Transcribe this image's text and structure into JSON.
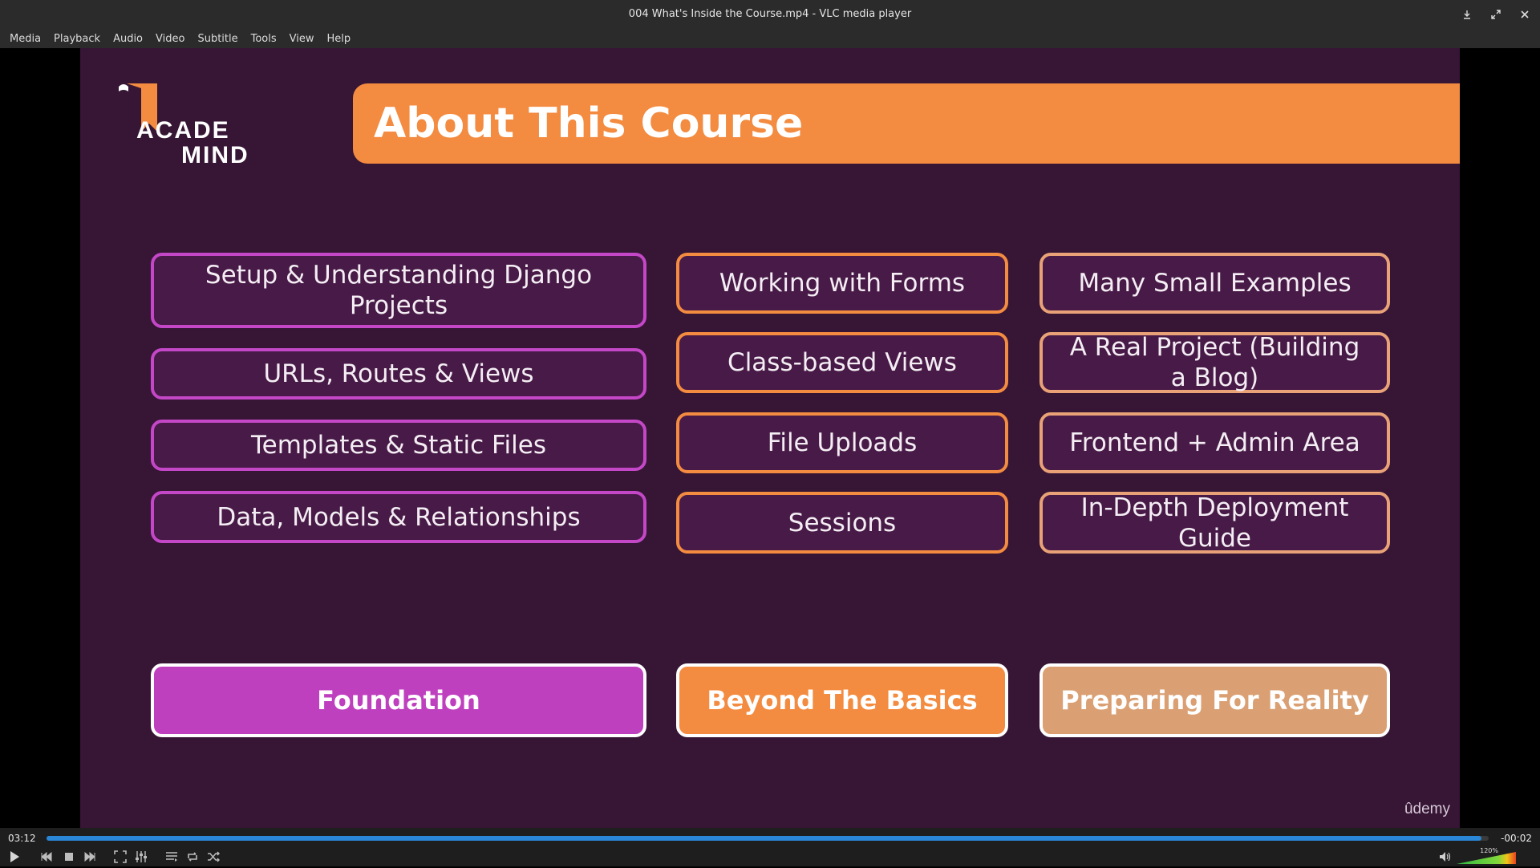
{
  "window": {
    "title": "004 What's Inside the Course.mp4 - VLC media player"
  },
  "menu": [
    "Media",
    "Playback",
    "Audio",
    "Video",
    "Subtitle",
    "Tools",
    "View",
    "Help"
  ],
  "slide": {
    "logo": {
      "line1": "ACADE",
      "line2": "MIND"
    },
    "title": "About This Course",
    "columns": [
      [
        "Setup & Understanding Django Projects",
        "URLs, Routes & Views",
        "Templates & Static Files",
        "Data, Models & Relationships"
      ],
      [
        "Working with Forms",
        "Class-based Views",
        "File Uploads",
        "Sessions"
      ],
      [
        "Many Small Examples",
        "A Real Project (Building a Blog)",
        "Frontend + Admin Area",
        "In-Depth Deployment Guide"
      ]
    ],
    "categories": [
      "Foundation",
      "Beyond The Basics",
      "Preparing For Reality"
    ],
    "watermark": "ûdemy",
    "colors": {
      "background": "#361535",
      "foundation": "#bf40bf",
      "beyond": "#f38b40",
      "reality": "#daa074"
    }
  },
  "player": {
    "elapsed": "03:12",
    "remaining": "-00:02",
    "progress": 0.995,
    "volume_label": "120%",
    "volume_level": 1.0,
    "accent": "#2a86d6"
  }
}
